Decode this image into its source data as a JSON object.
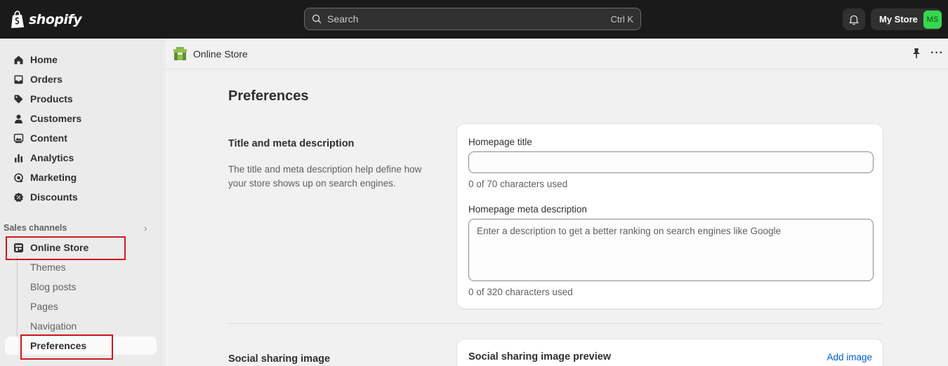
{
  "topbar": {
    "logo_text": "shopify",
    "search_placeholder": "Search",
    "search_shortcut": "Ctrl K",
    "store_name": "My Store",
    "avatar_initials": "MS"
  },
  "sidebar": {
    "items": [
      {
        "label": "Home",
        "icon": "home-icon"
      },
      {
        "label": "Orders",
        "icon": "inbox-icon"
      },
      {
        "label": "Products",
        "icon": "tag-icon"
      },
      {
        "label": "Customers",
        "icon": "person-icon"
      },
      {
        "label": "Content",
        "icon": "image-icon"
      },
      {
        "label": "Analytics",
        "icon": "bar-chart-icon"
      },
      {
        "label": "Marketing",
        "icon": "target-icon"
      },
      {
        "label": "Discounts",
        "icon": "discount-icon"
      }
    ],
    "sales_channels_label": "Sales channels",
    "online_store_label": "Online Store",
    "sub_items": [
      "Themes",
      "Blog posts",
      "Pages",
      "Navigation",
      "Preferences"
    ]
  },
  "pagebar": {
    "crumb": "Online Store"
  },
  "main": {
    "title": "Preferences",
    "title_meta": {
      "heading": "Title and meta description",
      "description": "The title and meta description help define how your store shows up on search engines.",
      "homepage_title_label": "Homepage title",
      "homepage_title_value": "",
      "homepage_title_help": "0 of 70 characters used",
      "meta_label": "Homepage meta description",
      "meta_placeholder": "Enter a description to get a better ranking on search engines like Google",
      "meta_help": "0 of 320 characters used"
    },
    "social": {
      "heading": "Social sharing image",
      "card_title": "Social sharing image preview",
      "add_image": "Add image"
    }
  },
  "colors": {
    "topbar_bg": "#1a1a1a",
    "highlight_red": "#d0171b",
    "link_blue": "#005bd3",
    "avatar_green": "#36d84e"
  }
}
